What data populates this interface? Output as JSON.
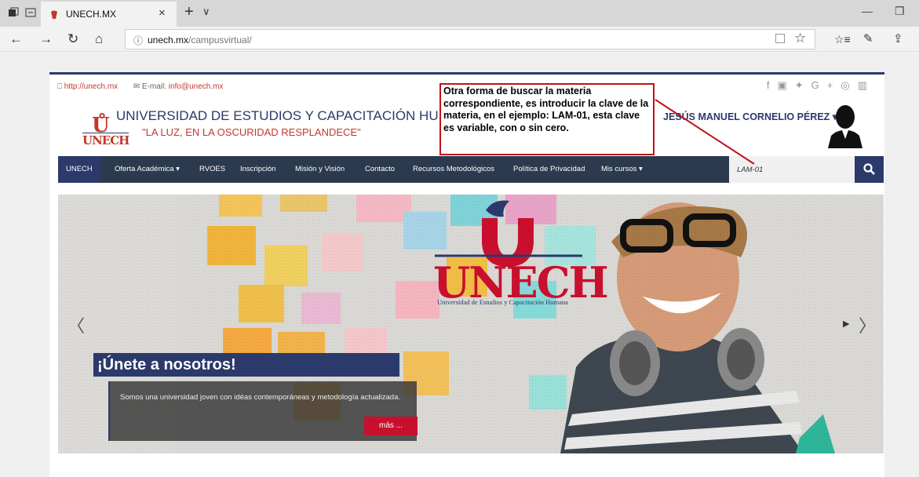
{
  "browser": {
    "tab_title": "UNECH.MX",
    "url_host": "unech.mx",
    "url_path": "/campusvirtual/"
  },
  "site": {
    "topbar": {
      "web_link": "http://unech.mx",
      "email_label": "E-mail:",
      "email": "info@unech.mx",
      "socials": [
        "f",
        "▣",
        "✦",
        "G+",
        "◎",
        "▥"
      ]
    },
    "logo_text": "UNECH",
    "university_name": "UNIVERSIDAD DE ESTUDIOS Y CAPACITACIÓN HUMANA",
    "motto": "\"LA LUZ, EN LA OSCURIDAD RESPLANDECE\"",
    "user_name": "JESÚS MANUEL CORNELIO PÉREZ",
    "annotation": "Otra forma de buscar la materia correspondiente, es introducir la clave de la materia, en el ejemplo: LAM-01, esta clave es variable, con o sin cero.",
    "menu": [
      {
        "label": "UNECH"
      },
      {
        "label": "Oferta Académica ▾"
      },
      {
        "label": "RVOES"
      },
      {
        "label": "Inscripción"
      },
      {
        "label": "Misión y Visión"
      },
      {
        "label": "Contacto"
      },
      {
        "label": "Recursos Metodológicos"
      },
      {
        "label": "Política de Privacidad"
      },
      {
        "label": "Mis cursos ▾"
      }
    ],
    "search_value": "LAM-01",
    "slider": {
      "logo_text": "UNECH",
      "logo_subtitle": "Universidad de Estudios y Capacitación Humana",
      "heading": "¡Únete a nosotros!",
      "text": "Somos una universidad joven con idéas contemporáneas y metodología actualizada.",
      "more_button": "más ..."
    }
  },
  "colors": {
    "navy": "#2b3a6b",
    "red": "#c0392b",
    "menu_bg": "#2b3a4e",
    "callout_border": "#c0121a"
  }
}
